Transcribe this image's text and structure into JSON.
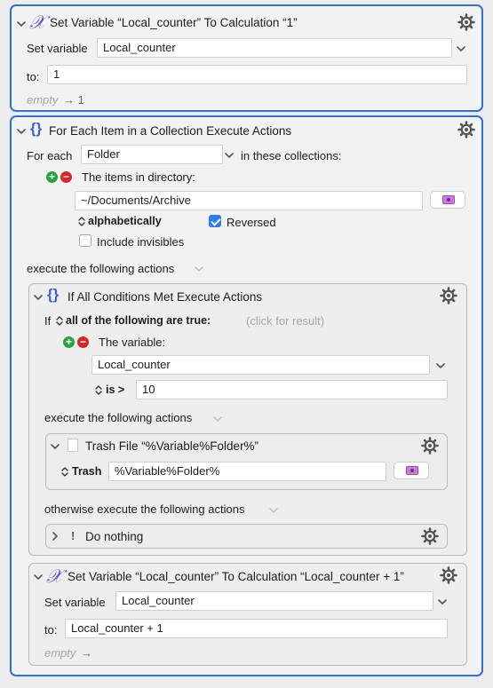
{
  "block1": {
    "title": "Set Variable “Local_counter” To Calculation “1”",
    "set_variable_label": "Set variable",
    "variable_value": "Local_counter",
    "to_label": "to:",
    "to_value": "1",
    "result_empty": "empty",
    "result_arrow": "→ 1"
  },
  "block2": {
    "title": "For Each Item in a Collection Execute Actions",
    "for_each_label": "For each",
    "for_each_value": "Folder",
    "in_collections_label": "in these collections:",
    "collection_label": "The items in directory:",
    "directory_value": "~/Documents/Archive",
    "sort_label": "alphabetically",
    "reversed_label": "Reversed",
    "reversed_checked": true,
    "include_invisibles_label": "Include invisibles",
    "include_invisibles_checked": false,
    "execute_label": "execute the following actions"
  },
  "block3": {
    "title": "If All Conditions Met Execute Actions",
    "if_label": "If",
    "condition_mode": "all of the following are true:",
    "click_for_result": "(click for result)",
    "condition_label": "The variable:",
    "variable_value": "Local_counter",
    "operator": "is >",
    "compare_value": "10",
    "execute_label": "execute the following actions",
    "otherwise_label": "otherwise execute the following actions"
  },
  "block4": {
    "title": "Trash File “%Variable%Folder%”",
    "action_label": "Trash",
    "path_value": "%Variable%Folder%"
  },
  "block5": {
    "title": "Do nothing",
    "icon_text": "!"
  },
  "block6": {
    "title": "Set Variable “Local_counter” To Calculation “Local_counter + 1”",
    "set_variable_label": "Set variable",
    "variable_value": "Local_counter",
    "to_label": "to:",
    "to_value": "Local_counter + 1",
    "result_empty": "empty",
    "result_arrow": "→"
  },
  "colors": {
    "selection_border": "#2f6fd6",
    "plus_green": "#27a53c",
    "minus_red": "#d6262b",
    "checkbox_blue": "#2f7bf1",
    "folder_purple": "#c97be0"
  }
}
